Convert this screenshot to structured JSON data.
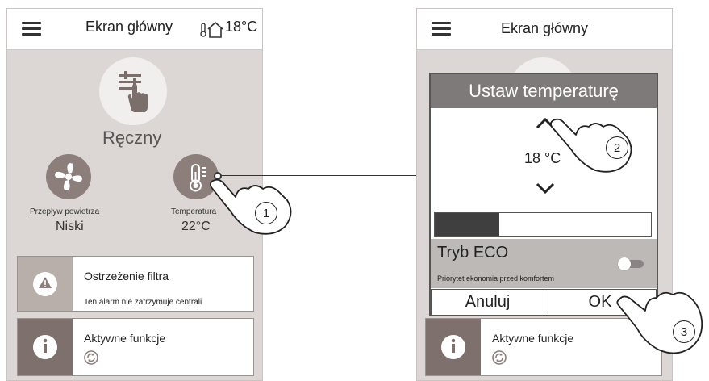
{
  "left_screen": {
    "title": "Ekran główny",
    "temperature_status": "18°C",
    "mode_label": "Ręczny",
    "airflow": {
      "label": "Przepływ powietrza",
      "value": "Niski"
    },
    "temperature": {
      "label": "Temperatura",
      "value": "22°C"
    },
    "filter_card": {
      "title": "Ostrzeżenie filtra",
      "subtitle": "Ten alarm nie zatrzymuje centrali"
    },
    "functions_card": {
      "title": "Aktywne funkcje"
    }
  },
  "right_screen": {
    "title": "Ekran główny",
    "dialog": {
      "title": "Ustaw temperaturę",
      "value": "18 °C",
      "eco_title": "Tryb ECO",
      "eco_subtitle": "Priorytet ekonomia przed komfortem",
      "cancel_label": "Anuluj",
      "ok_label": "OK",
      "level_fraction": 0.3
    },
    "functions_card": {
      "title": "Aktywne funkcje"
    }
  },
  "callouts": [
    "1",
    "2",
    "3"
  ],
  "colors": {
    "accent": "#8c7f7b",
    "panel": "#dcd7d4",
    "header": "#7e7a79"
  }
}
